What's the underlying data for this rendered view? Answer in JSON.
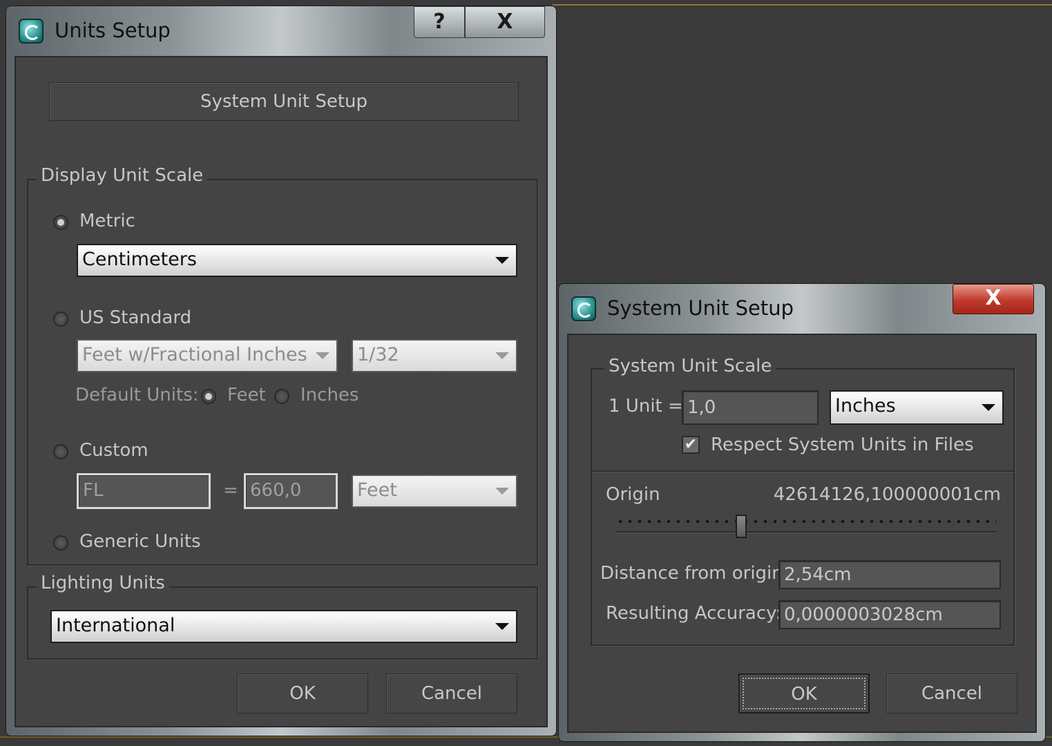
{
  "units_setup": {
    "title": "Units Setup",
    "help_label": "?",
    "close_label": "X",
    "system_unit_setup_button": "System Unit Setup",
    "display_unit_scale": {
      "legend": "Display Unit Scale",
      "metric_label": "Metric",
      "metric_value": "Centimeters",
      "us_standard_label": "US Standard",
      "us_standard_value": "Feet w/Fractional Inches",
      "us_fraction_value": "1/32",
      "default_units_label": "Default Units:",
      "feet_label": "Feet",
      "inches_label": "Inches",
      "custom_label": "Custom",
      "custom_name": "FL",
      "equals": "=",
      "custom_value": "660,0",
      "custom_unit": "Feet",
      "generic_label": "Generic Units",
      "selected": "metric"
    },
    "lighting_units": {
      "legend": "Lighting Units",
      "value": "International"
    },
    "ok_label": "OK",
    "cancel_label": "Cancel"
  },
  "system_unit_setup": {
    "title": "System Unit Setup",
    "close_label": "X",
    "scale": {
      "legend": "System Unit Scale",
      "one_unit_label": "1 Unit =",
      "one_unit_value": "1,0",
      "unit_value": "Inches",
      "respect_label": "Respect System Units in Files",
      "respect_checked": true
    },
    "origin": {
      "label": "Origin",
      "value": "42614126,100000001cm",
      "slider_position": 0.33
    },
    "distance_label": "Distance from origin:",
    "distance_value": "2,54cm",
    "accuracy_label": "Resulting Accuracy:",
    "accuracy_value": "0,0000003028cm",
    "ok_label": "OK",
    "cancel_label": "Cancel"
  }
}
